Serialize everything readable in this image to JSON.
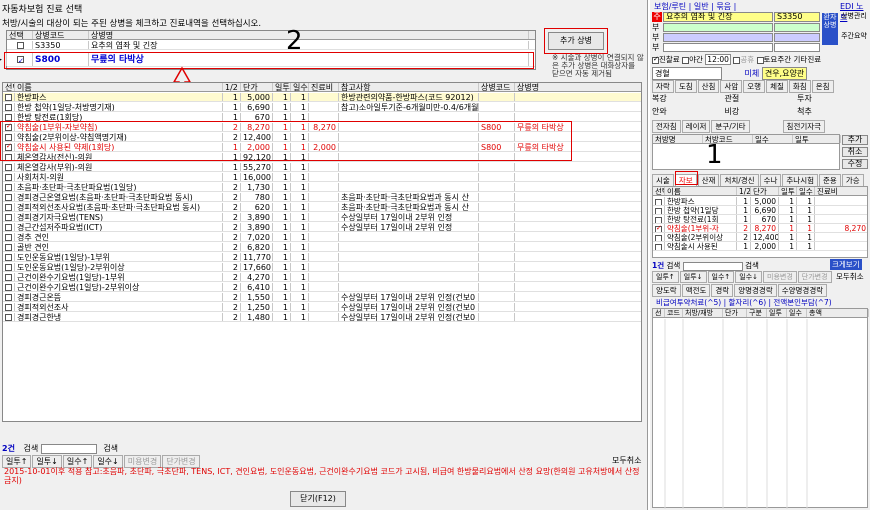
{
  "window": {
    "title": "자동차보험 진료 선택",
    "instruction": "처방/시술의 대상이 되는 주된 상병을 체크하고 진료내역을 선택하십시오."
  },
  "disease_table": {
    "headers": [
      "선택",
      "상병코드",
      "상병명"
    ],
    "rows": [
      {
        "code": "S3350",
        "name": "요추의 염좌 및 긴장",
        "checked": false,
        "marker": ""
      },
      {
        "code": "S800",
        "name": "무릎의 타박상",
        "checked": true,
        "marker": "▶"
      }
    ]
  },
  "add_button": "추가 상병",
  "notice": "※ 시술과 상병이 연결되지 않은 추가 상병은 대화상자를 닫으면 자동 제거됨",
  "treat_table": {
    "headers": [
      "선택",
      "이름",
      "1/2",
      "단가",
      "일투",
      "일수",
      "진료비",
      "참고사항",
      "상병코드",
      "상병명"
    ],
    "rows": [
      {
        "c": false,
        "name": "한방파스",
        "h": "1",
        "price": "5,000",
        "d": "1",
        "n": "1",
        "fee": "",
        "note": "한방관련의약품-한방파스(코드 92012)",
        "code": "",
        "dname": "",
        "style": "y"
      },
      {
        "c": false,
        "name": "한방 첩약(1일당-처방명기재)",
        "h": "1",
        "price": "6,690",
        "d": "1",
        "n": "1",
        "fee": "",
        "note": "참고)소아일투기준-6개월미만-0.4/6개월",
        "code": "",
        "dname": "",
        "style": ""
      },
      {
        "c": false,
        "name": "한방 탕전료(1회당)",
        "h": "1",
        "price": "670",
        "d": "1",
        "n": "1",
        "fee": "",
        "note": "",
        "code": "",
        "dname": "",
        "style": ""
      },
      {
        "c": true,
        "name": "약침술(1부위-자보약침)",
        "h": "2",
        "price": "8,270",
        "d": "1",
        "n": "1",
        "fee": "8,270",
        "note": "",
        "code": "S800",
        "dname": "무릎의 타박상",
        "style": "r"
      },
      {
        "c": false,
        "name": "약침술(2부위이상-약침액명기재)",
        "h": "2",
        "price": "12,400",
        "d": "1",
        "n": "1",
        "fee": "",
        "note": "",
        "code": "",
        "dname": "",
        "style": ""
      },
      {
        "c": true,
        "name": "약침술시 사용된 약제(1회당)",
        "h": "1",
        "price": "2,000",
        "d": "1",
        "n": "1",
        "fee": "2,000",
        "note": "",
        "code": "S800",
        "dname": "무릎의 타박상",
        "style": "r"
      },
      {
        "c": false,
        "name": "체온열감사(전신)-의원",
        "h": "1",
        "price": "92,120",
        "d": "1",
        "n": "1",
        "fee": "",
        "note": "",
        "code": "",
        "dname": "",
        "style": ""
      },
      {
        "c": false,
        "name": "체온열감사(부위)-의원",
        "h": "1",
        "price": "55,270",
        "d": "1",
        "n": "1",
        "fee": "",
        "note": "",
        "code": "",
        "dname": "",
        "style": ""
      },
      {
        "c": false,
        "name": "사회처치-의원",
        "h": "1",
        "price": "16,000",
        "d": "1",
        "n": "1",
        "fee": "",
        "note": "",
        "code": "",
        "dname": "",
        "style": ""
      },
      {
        "c": false,
        "name": "초음파·초단파·극초단파요법(1일당)",
        "h": "2",
        "price": "1,730",
        "d": "1",
        "n": "1",
        "fee": "",
        "note": "",
        "code": "",
        "dname": "",
        "style": ""
      },
      {
        "c": false,
        "name": "경피경근온열요법(초음파·초단파·극초단파요법 동시)",
        "h": "2",
        "price": "780",
        "d": "1",
        "n": "1",
        "fee": "",
        "note": "초음파·초단파·극초단파요법과 동시 산",
        "code": "",
        "dname": "",
        "style": ""
      },
      {
        "c": false,
        "name": "경피적외선조사요법(초음파·초단파·극초단파요법 동시)",
        "h": "2",
        "price": "620",
        "d": "1",
        "n": "1",
        "fee": "",
        "note": "초음파·초단파·극초단파요법과 동시 산",
        "code": "",
        "dname": "",
        "style": ""
      },
      {
        "c": false,
        "name": "경피경기자극요법(TENS)",
        "h": "2",
        "price": "3,890",
        "d": "1",
        "n": "1",
        "fee": "",
        "note": "수상일부터 17일이내 2부위 인정",
        "code": "",
        "dname": "",
        "style": ""
      },
      {
        "c": false,
        "name": "경근간섭저주파요법(ICT)",
        "h": "2",
        "price": "3,890",
        "d": "1",
        "n": "1",
        "fee": "",
        "note": "수상일부터 17일이내 2부위 인정",
        "code": "",
        "dname": "",
        "style": ""
      },
      {
        "c": false,
        "name": "경추 견인",
        "h": "2",
        "price": "7,020",
        "d": "1",
        "n": "1",
        "fee": "",
        "note": "",
        "code": "",
        "dname": "",
        "style": ""
      },
      {
        "c": false,
        "name": "골반 견인",
        "h": "2",
        "price": "6,820",
        "d": "1",
        "n": "1",
        "fee": "",
        "note": "",
        "code": "",
        "dname": "",
        "style": ""
      },
      {
        "c": false,
        "name": "도인운동요법(1일당)-1부위",
        "h": "2",
        "price": "11,770",
        "d": "1",
        "n": "1",
        "fee": "",
        "note": "",
        "code": "",
        "dname": "",
        "style": ""
      },
      {
        "c": false,
        "name": "도인운동요법(1일당)-2부위이상",
        "h": "2",
        "price": "17,660",
        "d": "1",
        "n": "1",
        "fee": "",
        "note": "",
        "code": "",
        "dname": "",
        "style": ""
      },
      {
        "c": false,
        "name": "근건이완수기요법(1일당)-1부위",
        "h": "2",
        "price": "4,270",
        "d": "1",
        "n": "1",
        "fee": "",
        "note": "",
        "code": "",
        "dname": "",
        "style": ""
      },
      {
        "c": false,
        "name": "근건이완수기요법(1일당)-2부위이상",
        "h": "2",
        "price": "6,410",
        "d": "1",
        "n": "1",
        "fee": "",
        "note": "",
        "code": "",
        "dname": "",
        "style": ""
      },
      {
        "c": false,
        "name": "경피경근온뜸",
        "h": "2",
        "price": "1,550",
        "d": "1",
        "n": "1",
        "fee": "",
        "note": "수상일부터 17일이내 2부위 인정(건보0",
        "code": "",
        "dname": "",
        "style": ""
      },
      {
        "c": false,
        "name": "경피적외선조사",
        "h": "2",
        "price": "1,250",
        "d": "1",
        "n": "1",
        "fee": "",
        "note": "수상일부터 17일이내 2부위 인정(건보0",
        "code": "",
        "dname": "",
        "style": ""
      },
      {
        "c": false,
        "name": "경피경근한냉",
        "h": "2",
        "price": "1,480",
        "d": "1",
        "n": "1",
        "fee": "",
        "note": "수상일부터 17일이내 2부위 인정(건보0",
        "code": "",
        "dname": "",
        "style": ""
      }
    ]
  },
  "bottom": {
    "count": "2건",
    "search_label": "검색",
    "search_btn": "검색",
    "tools": [
      "일투↑",
      "일투↓",
      "일수↑",
      "일수↓",
      "미용변경",
      "단가변경"
    ],
    "cancel_all": "모두취소",
    "warning": "2015-10-01이후 적용 참고:초음파, 초단파, 극초단파, TENS, ICT, 견인요법, 도인운동요법, 근건이완수기요법 코드가 고시됨, 비급여 한방물리요법에서 산정 요망(한의원 고유처방에서 산정 금지)",
    "close_btn": "닫기(F12)"
  },
  "annotations": [
    "1",
    "2",
    "3"
  ],
  "right": {
    "top_tabs": "보험/루틴 | 일반 | 묶음 |",
    "edi_btn": "EDI 노트",
    "main_label": "주",
    "main_disease": "요추의 염좌 및 긴장",
    "main_code": "S3350",
    "sub_labels": [
      "부",
      "부",
      "부"
    ],
    "side_btns": [
      "환자상병",
      "상병관리",
      "주간요약"
    ],
    "time_row": [
      "진찰료",
      "야간",
      "12:00",
      "공휴",
      "토요주간",
      "기타진료"
    ],
    "drop1": [
      "경혈",
      "미체",
      "견우,요양관"
    ],
    "buttons_row": [
      "자락",
      "도침",
      "산침",
      "사암",
      "오행",
      "체질",
      "화침",
      "온침"
    ],
    "dd_rows": [
      [
        "복강",
        "관절",
        "투자"
      ],
      [
        "안와",
        "비강",
        "척추"
      ]
    ],
    "action_row": [
      "전자침",
      "레이저",
      "분구/기타",
      "침전기자극"
    ],
    "sub_table_headers": [
      "처방명",
      "처방코드",
      "일수",
      "일투",
      "추가"
    ],
    "sub_btns": [
      "추가",
      "취소",
      "수정"
    ],
    "mini_tabs": [
      "시술",
      "자보",
      "산재",
      "처치/경신",
      "수나",
      "추나시험",
      "준용",
      "가승"
    ],
    "mini_headers": [
      "선택",
      "이름",
      "1/2",
      "단가",
      "일투",
      "일수",
      "진료비"
    ],
    "mini_rows": [
      {
        "c": false,
        "name": "한방파스",
        "h": "1",
        "p": "5,000",
        "d": "1",
        "n": "1",
        "fee": ""
      },
      {
        "c": false,
        "name": "한방 첩약(1일당",
        "h": "1",
        "p": "6,690",
        "d": "1",
        "n": "1",
        "fee": ""
      },
      {
        "c": false,
        "name": "한방 탕전료(1회",
        "h": "1",
        "p": "670",
        "d": "1",
        "n": "1",
        "fee": ""
      },
      {
        "c": true,
        "name": "약침술(1부위-자",
        "h": "2",
        "p": "8,270",
        "d": "1",
        "n": "1",
        "fee": "8,270"
      },
      {
        "c": false,
        "name": "약침술(2부위이상",
        "h": "2",
        "p": "12,400",
        "d": "1",
        "n": "1",
        "fee": ""
      },
      {
        "c": false,
        "name": "약침술시 사용된",
        "h": "1",
        "p": "2,000",
        "d": "1",
        "n": "1",
        "fee": ""
      }
    ],
    "mini_count": "1건",
    "mini_search": "검색",
    "mini_search_btn": "검색",
    "big_view": "크게보기",
    "mini_tools": [
      "일투↑",
      "일투↓",
      "일수↑",
      "일수↓",
      "미용변경",
      "단가변경"
    ],
    "mini_cancel": "모두취소",
    "lower_tabs": [
      "양도락",
      "맥전도",
      "경락",
      "양명경경락",
      "수양명경경락"
    ],
    "fee_tabs": [
      "비급여투약처료(^5)",
      "할자리(^6)",
      "전액본인부담(^7)"
    ],
    "fee_headers": [
      "선",
      "코드",
      "처방/재방",
      "단가",
      "구분",
      "일투",
      "일수",
      "총액"
    ],
    "fee_row_partial": "1  xxxxx  xxxxxx  1xxxxx  1  1  1xxxxxx"
  }
}
